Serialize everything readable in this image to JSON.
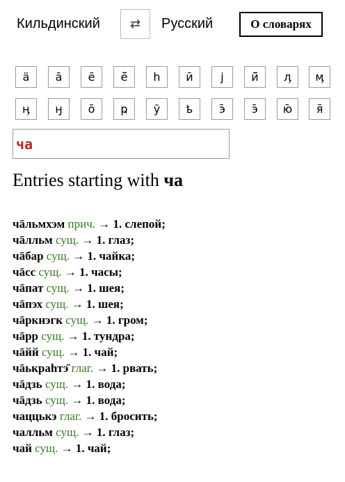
{
  "header": {
    "source_lang": "Кильдинский",
    "target_lang": "Русский",
    "swap_glyph": "⇄",
    "about_label": "О словарях"
  },
  "keyboard": {
    "row1": [
      "ä",
      "ā",
      "ē",
      "ё̄",
      "һ",
      "ӣ",
      "ј",
      "ӣ̆",
      "ӆ",
      "ӎ"
    ],
    "row2": [
      "ӊ",
      "ӈ",
      "ō",
      "ҏ",
      "ӯ",
      "ҍ",
      "э̄",
      "э̄",
      "ю̄",
      "я̄"
    ]
  },
  "search": {
    "value": "ча"
  },
  "results": {
    "heading_prefix": "Entries starting with",
    "heading_query": "ча",
    "entries": [
      {
        "word": "чāльмхэм",
        "pos": "прич.",
        "translation": "1. слепой;"
      },
      {
        "word": "чāлльм",
        "pos": "сущ.",
        "translation": "1. глаз;"
      },
      {
        "word": "чāбар",
        "pos": "сущ.",
        "translation": "1. чайка;"
      },
      {
        "word": "чāсс",
        "pos": "сущ.",
        "translation": "1. часы;"
      },
      {
        "word": "чāпат",
        "pos": "сущ.",
        "translation": "1. шея;"
      },
      {
        "word": "чāпэх",
        "pos": "сущ.",
        "translation": "1. шея;"
      },
      {
        "word": "чāркнэгк",
        "pos": "сущ.",
        "translation": "1. гром;"
      },
      {
        "word": "чāрр",
        "pos": "сущ.",
        "translation": "1. тундра;"
      },
      {
        "word": "чāйй",
        "pos": "сущ.",
        "translation": "1. чай;"
      },
      {
        "word": "чāькраһтэ̄",
        "pos": "глаг.",
        "translation": "1. рвать;"
      },
      {
        "word": "чāдзь",
        "pos": "сущ.",
        "translation": "1. вода;"
      },
      {
        "word": "чāдзь",
        "pos": "сущ.",
        "translation": "1. вода;"
      },
      {
        "word": "чаццькэ",
        "pos": "глаг.",
        "translation": "1. бросить;"
      },
      {
        "word": "чалльм",
        "pos": "сущ.",
        "translation": "1. глаз;"
      },
      {
        "word": "чай",
        "pos": "сущ.",
        "translation": "1. чай;"
      }
    ]
  }
}
